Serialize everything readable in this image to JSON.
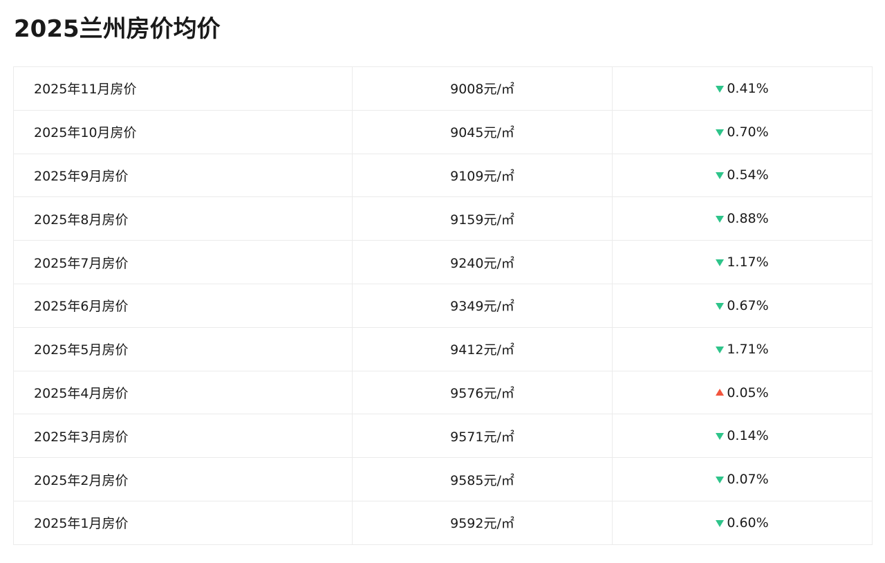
{
  "page": {
    "title": "2025兰州房价均价"
  },
  "colors": {
    "down": "#2ec48a",
    "up": "#f2553d",
    "border": "#ebebeb",
    "text": "#1a1a1a"
  },
  "rows": [
    {
      "month": "2025年11月房价",
      "price": "9008元/㎡",
      "direction": "down",
      "change": "0.41%"
    },
    {
      "month": "2025年10月房价",
      "price": "9045元/㎡",
      "direction": "down",
      "change": "0.70%"
    },
    {
      "month": "2025年9月房价",
      "price": "9109元/㎡",
      "direction": "down",
      "change": "0.54%"
    },
    {
      "month": "2025年8月房价",
      "price": "9159元/㎡",
      "direction": "down",
      "change": "0.88%"
    },
    {
      "month": "2025年7月房价",
      "price": "9240元/㎡",
      "direction": "down",
      "change": "1.17%"
    },
    {
      "month": "2025年6月房价",
      "price": "9349元/㎡",
      "direction": "down",
      "change": "0.67%"
    },
    {
      "month": "2025年5月房价",
      "price": "9412元/㎡",
      "direction": "down",
      "change": "1.71%"
    },
    {
      "month": "2025年4月房价",
      "price": "9576元/㎡",
      "direction": "up",
      "change": "0.05%"
    },
    {
      "month": "2025年3月房价",
      "price": "9571元/㎡",
      "direction": "down",
      "change": "0.14%"
    },
    {
      "month": "2025年2月房价",
      "price": "9585元/㎡",
      "direction": "down",
      "change": "0.07%"
    },
    {
      "month": "2025年1月房价",
      "price": "9592元/㎡",
      "direction": "down",
      "change": "0.60%"
    }
  ]
}
